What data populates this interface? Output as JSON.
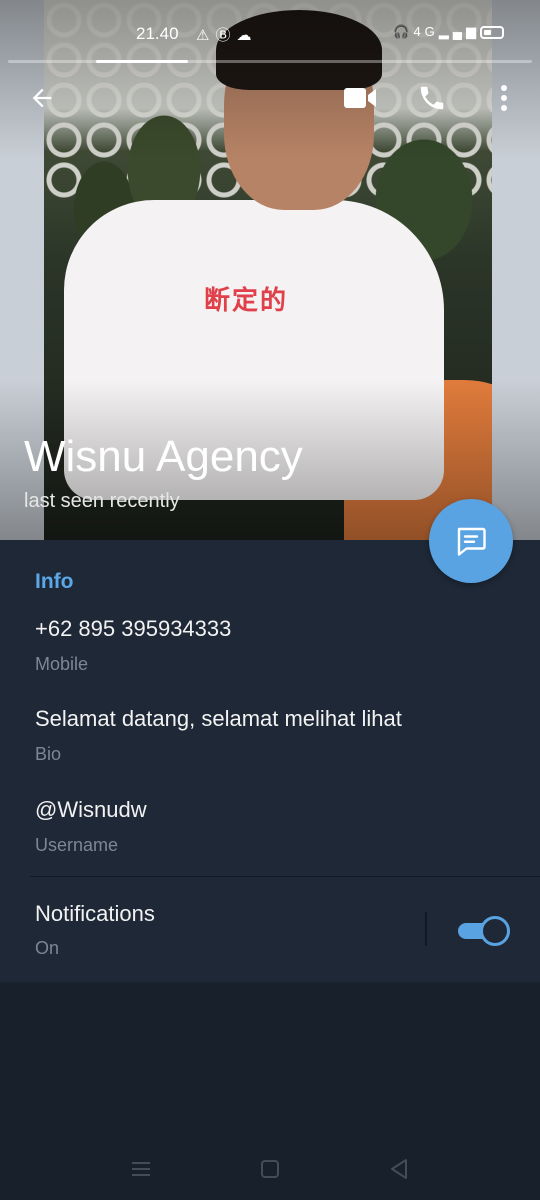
{
  "status_bar": {
    "time": "21.40",
    "network": "4G"
  },
  "top_actions": {
    "back_icon": "arrow-left-icon",
    "video_icon": "video-camera-icon",
    "call_icon": "phone-icon",
    "more_icon": "more-vertical-icon"
  },
  "profile": {
    "name": "Wisnu Agency",
    "status": "last seen recently"
  },
  "info": {
    "section_title": "Info",
    "phone": {
      "value": "+62 895 395934333",
      "label": "Mobile"
    },
    "bio": {
      "value": "Selamat datang, selamat melihat lihat",
      "label": "Bio"
    },
    "username": {
      "value": "@Wisnudw",
      "label": "Username"
    }
  },
  "notifications": {
    "title": "Notifications",
    "state": "On",
    "enabled": true
  },
  "colors": {
    "accent": "#5aa3e2",
    "card_bg": "#1e2836",
    "page_bg": "#18202b"
  }
}
